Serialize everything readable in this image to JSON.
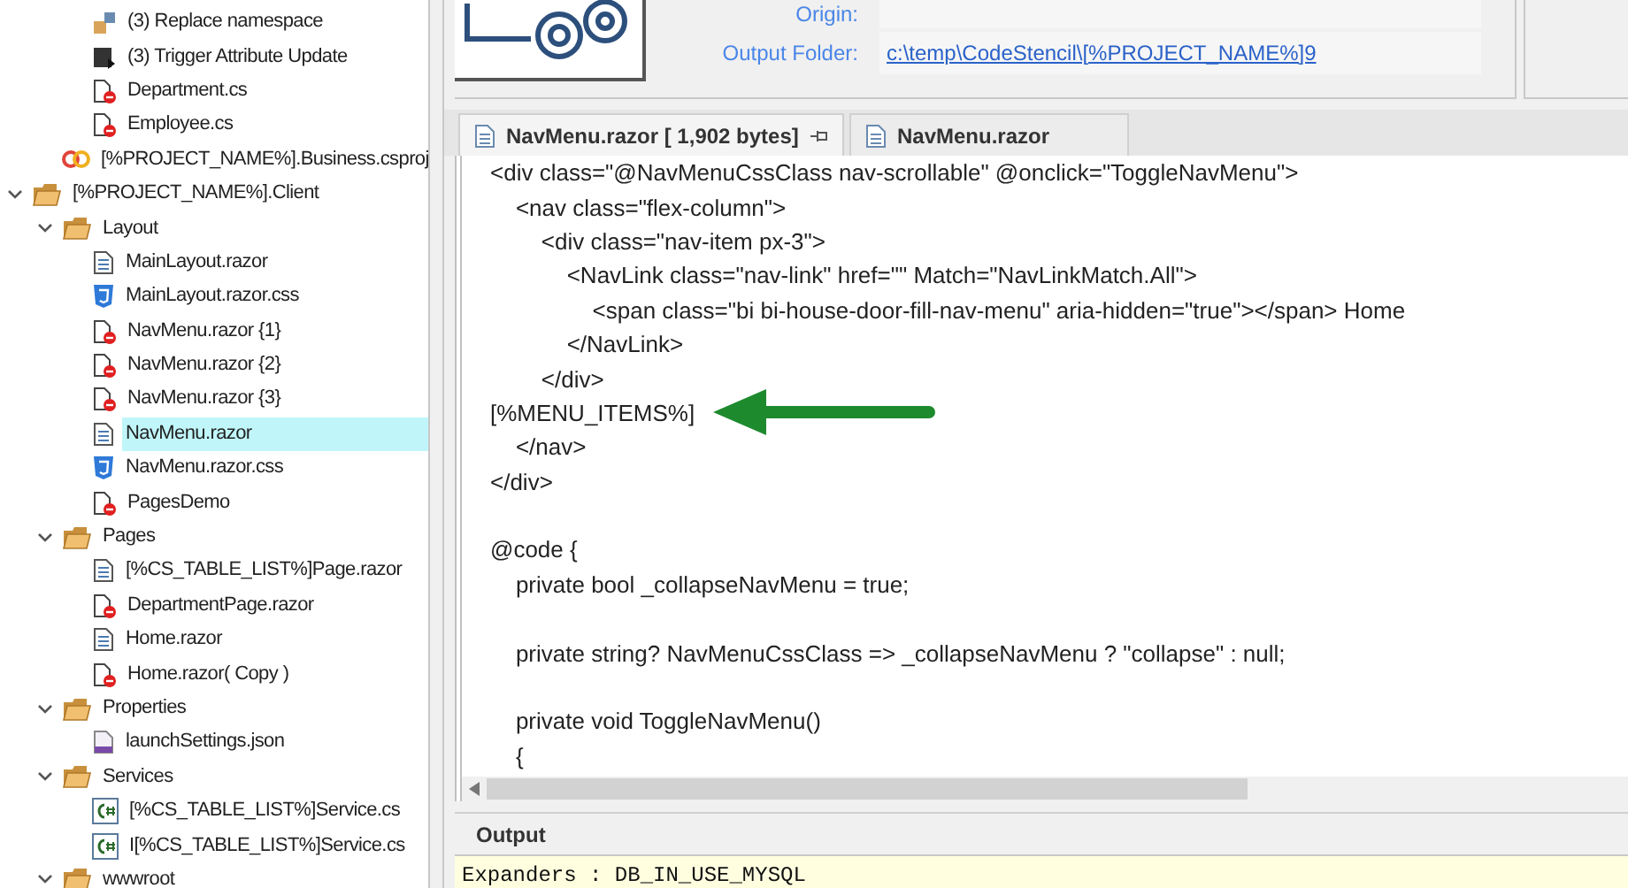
{
  "tree": [
    {
      "children": [
        {
          "children": [
            {
              "label": "(3) Replace namespace",
              "kind": "namespace",
              "selected": false
            },
            {
              "label": "(3) Trigger Attribute Update",
              "kind": "trigger",
              "selected": false
            },
            {
              "label": "Department.cs",
              "kind": "excluded",
              "selected": false
            },
            {
              "label": "Employee.cs",
              "kind": "excluded",
              "selected": false
            }
          ]
        },
        {
          "label": "[%PROJECT_NAME%].Business.csproj",
          "kind": "csproj",
          "selected": false
        }
      ]
    },
    {
      "label": "[%PROJECT_NAME%].Client",
      "kind": "folder",
      "expanded": true,
      "selected": false,
      "children": [
        {
          "label": "Layout",
          "kind": "folder",
          "expanded": true,
          "selected": false,
          "children": [
            {
              "label": "MainLayout.razor",
              "kind": "razor",
              "selected": false
            },
            {
              "label": "MainLayout.razor.css",
              "kind": "css",
              "selected": false
            },
            {
              "label": "NavMenu.razor {1}",
              "kind": "excluded",
              "selected": false
            },
            {
              "label": "NavMenu.razor {2}",
              "kind": "excluded",
              "selected": false
            },
            {
              "label": "NavMenu.razor {3}",
              "kind": "excluded",
              "selected": false
            },
            {
              "label": "NavMenu.razor",
              "kind": "razor",
              "selected": true
            },
            {
              "label": "NavMenu.razor.css",
              "kind": "css",
              "selected": false
            },
            {
              "label": "PagesDemo",
              "kind": "excluded",
              "selected": false
            }
          ]
        },
        {
          "label": "Pages",
          "kind": "folder",
          "expanded": true,
          "selected": false,
          "children": [
            {
              "label": "[%CS_TABLE_LIST%]Page.razor",
              "kind": "razor",
              "selected": false
            },
            {
              "label": "DepartmentPage.razor",
              "kind": "excluded",
              "selected": false
            },
            {
              "label": "Home.razor",
              "kind": "razor",
              "selected": false
            },
            {
              "label": "Home.razor( Copy )",
              "kind": "excluded",
              "selected": false
            }
          ]
        },
        {
          "label": "Properties",
          "kind": "folder",
          "expanded": true,
          "selected": false,
          "children": [
            {
              "label": "launchSettings.json",
              "kind": "json",
              "selected": false
            }
          ]
        },
        {
          "label": "Services",
          "kind": "folder",
          "expanded": true,
          "selected": false,
          "children": [
            {
              "label": "[%CS_TABLE_LIST%]Service.cs",
              "kind": "csharp",
              "selected": false
            },
            {
              "label": "I[%CS_TABLE_LIST%]Service.cs",
              "kind": "csharp",
              "selected": false
            }
          ]
        },
        {
          "label": "wwwroot",
          "kind": "folder",
          "expanded": true,
          "selected": false
        }
      ]
    }
  ],
  "details": {
    "origin_label": "Origin:",
    "output_folder_label": "Output Folder:",
    "output_folder": "c:\\temp\\CodeStencil\\[%PROJECT_NAME%]9"
  },
  "tabs": [
    {
      "label": "NavMenu.razor [ 1,902 bytes]",
      "selected": true,
      "pinned": true
    },
    {
      "label": "NavMenu.razor",
      "selected": false,
      "pinned": false
    }
  ],
  "code": [
    {
      "kind": "text",
      "text": "<div class=\"@NavMenuCssClass nav-scrollable\" @onclick=\"ToggleNavMenu\">"
    },
    {
      "kind": "text",
      "text": "    <nav class=\"flex-column\">"
    },
    {
      "kind": "text",
      "text": "        <div class=\"nav-item px-3\">"
    },
    {
      "kind": "text",
      "text": "            <NavLink class=\"nav-link\" href=\"\" Match=\"NavLinkMatch.All\">"
    },
    {
      "kind": "text",
      "text": "                <span class=\"bi bi-house-door-fill-nav-menu\" aria-hidden=\"true\"></span> Home"
    },
    {
      "kind": "text",
      "text": "            </NavLink>"
    },
    {
      "kind": "text",
      "text": "        </div>"
    },
    {
      "kind": "text",
      "text": "[%MENU_ITEMS%]",
      "arrow": true
    },
    {
      "kind": "text",
      "text": "    </nav>"
    },
    {
      "kind": "text",
      "text": "</div>"
    },
    {
      "kind": "blank"
    },
    {
      "kind": "text",
      "text": "@code {"
    },
    {
      "kind": "text",
      "text": "    private bool _collapseNavMenu = true;"
    },
    {
      "kind": "blank"
    },
    {
      "kind": "text",
      "text": "    private string? NavMenuCssClass => _collapseNavMenu ? \"collapse\" : null;"
    },
    {
      "kind": "blank"
    },
    {
      "kind": "text",
      "text": "    private void ToggleNavMenu()"
    },
    {
      "kind": "text",
      "text": "    {"
    }
  ],
  "output": {
    "title": "Output",
    "lines": [
      "Expanders : DB_IN_USE_MYSQL"
    ]
  }
}
